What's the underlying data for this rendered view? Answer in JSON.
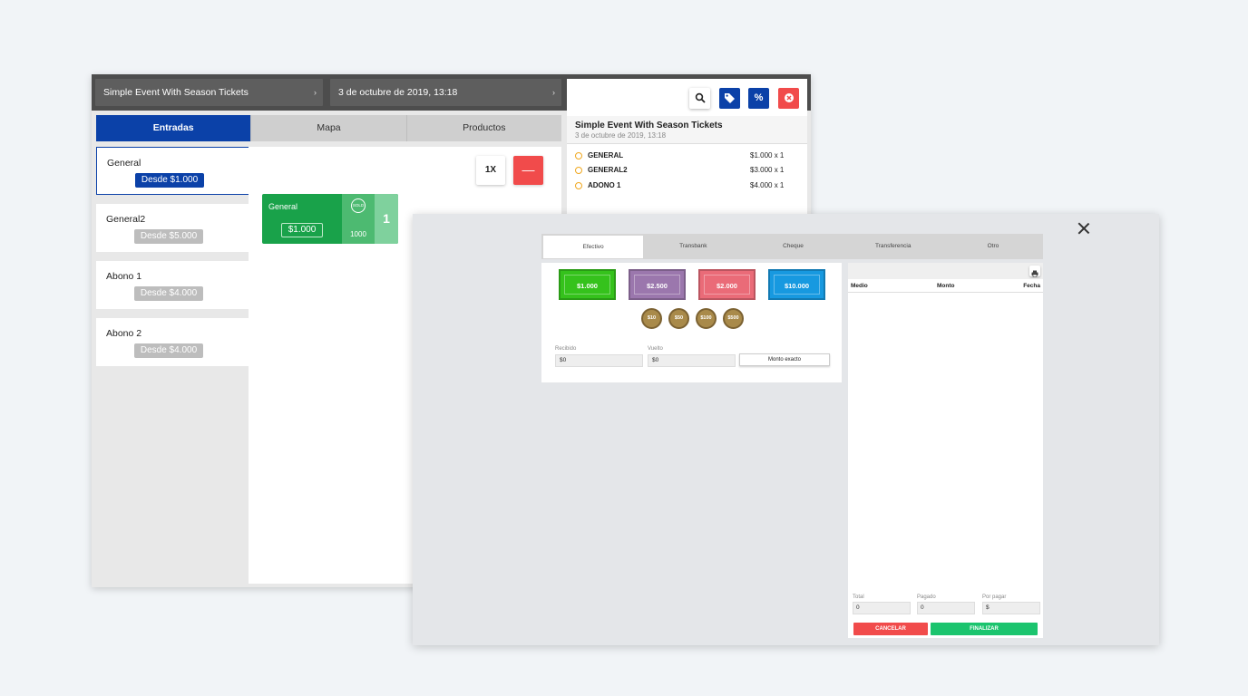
{
  "event_bar": {
    "event_name": "Simple Event With Season Tickets",
    "event_date": "3 de octubre de 2019, 13:18",
    "chevron": "›"
  },
  "tabs": [
    {
      "label": "Entradas",
      "active": true
    },
    {
      "label": "Mapa",
      "active": false
    },
    {
      "label": "Productos",
      "active": false
    }
  ],
  "categories": [
    {
      "name": "General",
      "price": "Desde $1.000"
    },
    {
      "name": "General2",
      "price": "Desde $5.000"
    },
    {
      "name": "Abono 1",
      "price": "Desde $4.000"
    },
    {
      "name": "Abono 2",
      "price": "Desde $4.000"
    }
  ],
  "controls": {
    "multiplier": "1X",
    "minus": "—"
  },
  "ticket_card": {
    "name": "General",
    "price": "$1.000",
    "sold_badge": "SOLD",
    "stock": "1000",
    "quantity": "1"
  },
  "summary": {
    "title": "Simple Event With Season Tickets",
    "date": "3 de octubre de 2019, 13:18",
    "percent_label": "%",
    "items": [
      {
        "name": "GENERAL",
        "price": "$1.000 x 1"
      },
      {
        "name": "GENERAL2",
        "price": "$3.000 x 1"
      },
      {
        "name": "ADONO 1",
        "price": "$4.000 x 1"
      }
    ]
  },
  "payment": {
    "tabs": [
      {
        "label": "Efectivo",
        "active": true
      },
      {
        "label": "Transbank",
        "active": false
      },
      {
        "label": "Cheque",
        "active": false
      },
      {
        "label": "Transferencia",
        "active": false
      },
      {
        "label": "Otro",
        "active": false
      }
    ],
    "bills": [
      "$1.000",
      "$2.500",
      "$2.000",
      "$10.000"
    ],
    "coins": [
      "$10",
      "$50",
      "$100",
      "$500"
    ],
    "received_label": "Recibido",
    "received_value": "$0",
    "change_label": "Vuelto",
    "change_value": "$0",
    "exact_button": "Monto exacto",
    "history_headers": [
      "Medio",
      "Monto",
      "Fecha"
    ],
    "total_label": "Total",
    "total_value": "0",
    "paid_label": "Pagado",
    "paid_value": "0",
    "due_label": "Por pagar",
    "due_value": "$",
    "cancel_button": "CANCELAR",
    "finish_button": "FINALIZAR"
  },
  "colors": {
    "primary": "#0b41a8",
    "danger": "#f14b4b",
    "success": "#19a24a",
    "finish": "#1bc46e"
  }
}
